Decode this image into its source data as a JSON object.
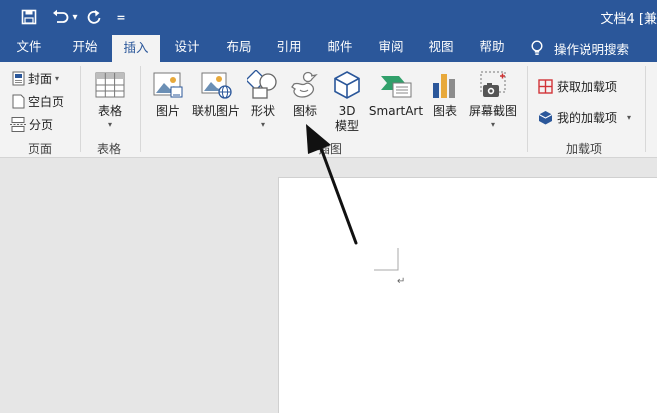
{
  "window": {
    "title": "文档4 [兼"
  },
  "quick_access": {
    "icons": [
      "save-icon",
      "undo-icon",
      "redo-icon",
      "customize-icon"
    ],
    "undo_dropdown_glyph": "▾",
    "customize_glyph": "="
  },
  "tabs": [
    {
      "label": "文件",
      "active": false
    },
    {
      "label": "开始",
      "active": false
    },
    {
      "label": "插入",
      "active": true
    },
    {
      "label": "设计",
      "active": false
    },
    {
      "label": "布局",
      "active": false
    },
    {
      "label": "引用",
      "active": false
    },
    {
      "label": "邮件",
      "active": false
    },
    {
      "label": "审阅",
      "active": false
    },
    {
      "label": "视图",
      "active": false
    },
    {
      "label": "帮助",
      "active": false
    }
  ],
  "tell_me": {
    "label": "操作说明搜索",
    "icon": "lightbulb-icon"
  },
  "ribbon": {
    "pages_group": {
      "label": "页面",
      "cover": "封面",
      "blank": "空白页",
      "break": "分页"
    },
    "tables_group": {
      "label": "表格",
      "table": "表格"
    },
    "illustrations_group": {
      "label": "插图",
      "pictures": "图片",
      "online_pictures": "联机图片",
      "shapes": "形状",
      "icons": "图标",
      "model3d_line1": "3D",
      "model3d_line2": "模型",
      "smartart": "SmartArt",
      "chart": "图表",
      "screenshot": "屏幕截图"
    },
    "addins_group": {
      "label": "加载项",
      "get_addins": "获取加载项",
      "my_addins": "我的加载项"
    }
  },
  "document": {
    "paragraph_mark": "↵"
  },
  "colors": {
    "brand": "#2b579a",
    "ribbon_bg": "#f3f3f3",
    "canvas_bg": "#e6e6e6"
  }
}
